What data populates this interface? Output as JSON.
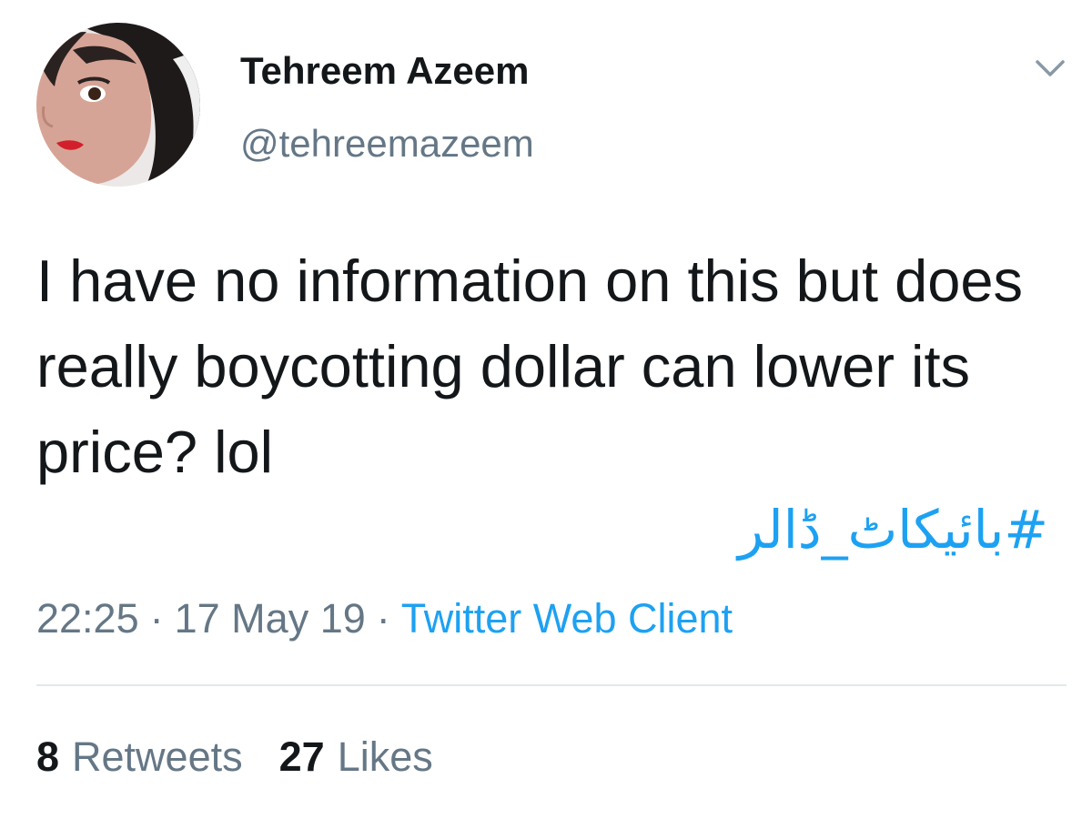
{
  "tweet": {
    "author": {
      "name": "Tehreem Azeem",
      "handle": "@tehreemazeem"
    },
    "text": "I have no information on this but does really boycotting dollar can lower its price? lol",
    "hashtag": "#بائیکاٹ_ڈالر",
    "time": "22:25",
    "separator": "·",
    "date": "17 May 19",
    "client": "Twitter Web Client",
    "stats": {
      "retweets_count": "8",
      "retweets_label": "Retweets",
      "likes_count": "27",
      "likes_label": "Likes"
    }
  },
  "icons": {
    "menu": "chevron-down-icon",
    "avatar": "avatar"
  },
  "colors": {
    "text": "#14171a",
    "secondary": "#657786",
    "link": "#1da1f2",
    "divider": "#e1e8ed"
  }
}
